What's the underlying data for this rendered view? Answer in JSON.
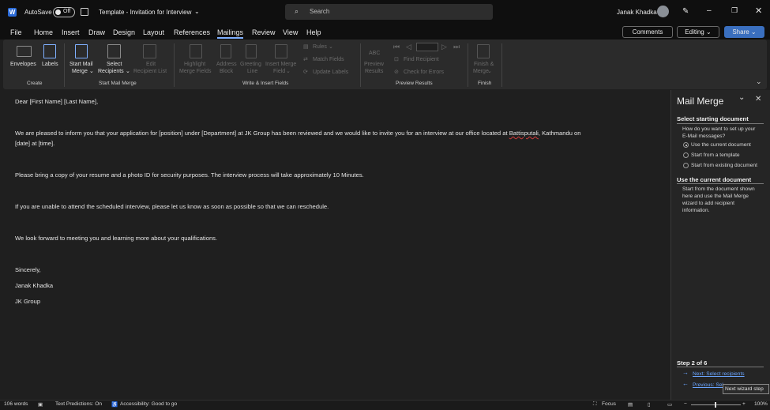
{
  "titlebar": {
    "autosave_label": "AutoSave",
    "autosave_state": "Off",
    "doc_title": "Template - Invitation for Interview",
    "search_placeholder": "Search",
    "user_name": "Janak Khadka"
  },
  "menu": {
    "tabs": [
      "File",
      "Home",
      "Insert",
      "Draw",
      "Design",
      "Layout",
      "References",
      "Mailings",
      "Review",
      "View",
      "Help"
    ],
    "active": "Mailings",
    "comments_label": "Comments",
    "editing_label": "Editing",
    "share_label": "Share"
  },
  "ribbon": {
    "create": {
      "envelopes": "Envelopes",
      "labels": "Labels",
      "group": "Create"
    },
    "start": {
      "start_mail_merge_1": "Start Mail",
      "start_mail_merge_2": "Merge",
      "select_recipients_1": "Select",
      "select_recipients_2": "Recipients",
      "edit_list_1": "Edit",
      "edit_list_2": "Recipient List",
      "group": "Start Mail Merge"
    },
    "write": {
      "highlight_1": "Highlight",
      "highlight_2": "Merge Fields",
      "address_1": "Address",
      "address_2": "Block",
      "greeting_1": "Greeting",
      "greeting_2": "Line",
      "insert_1": "Insert Merge",
      "insert_2": "Field",
      "rules": "Rules",
      "match": "Match Fields",
      "update": "Update Labels",
      "group": "Write & Insert Fields"
    },
    "preview": {
      "abc": "ABC",
      "preview_1": "Preview",
      "preview_2": "Results",
      "find": "Find Recipient",
      "check": "Check for Errors",
      "group": "Preview Results"
    },
    "finish": {
      "finish_1": "Finish &",
      "finish_2": "Merge",
      "group": "Finish"
    }
  },
  "document": {
    "lines": [
      "Dear [First Name] [Last Name],",
      "We are pleased to inform you that your application for [position] under [Department] at JK Group has been reviewed and we would like to invite you for an interview at our office located at ",
      "Battisputali",
      ", Kathmandu on",
      "[date] at [time].",
      "Please bring a copy of your resume and a photo ID for security purposes. The interview process will take approximately 10 Minutes.",
      "If you are unable to attend the scheduled interview, please let us know as soon as possible so that we can reschedule.",
      "We look forward to meeting you and learning more about your qualifications.",
      "Sincerely,",
      "Janak Khadka",
      "JK Group"
    ]
  },
  "pane": {
    "title": "Mail Merge",
    "section1_heading": "Select starting document",
    "question_1": "How do you want to set up your",
    "question_2": "E-Mail messages?",
    "options": [
      "Use the current document",
      "Start from a template",
      "Start from existing document"
    ],
    "selected_option": 0,
    "section2_heading": "Use the current document",
    "desc_1": "Start from the document shown",
    "desc_2": "here and use the Mail Merge",
    "desc_3": "wizard to add recipient",
    "desc_4": "information.",
    "step": "Step 2 of 6",
    "next_link": "Next: Select recipients",
    "prev_link": "Previous: Sel",
    "tooltip": "Next wizard step"
  },
  "status": {
    "words": "106 words",
    "text_predictions": "Text Predictions: On",
    "accessibility": "Accessibility: Good to go",
    "focus": "Focus",
    "zoom": "100%"
  }
}
